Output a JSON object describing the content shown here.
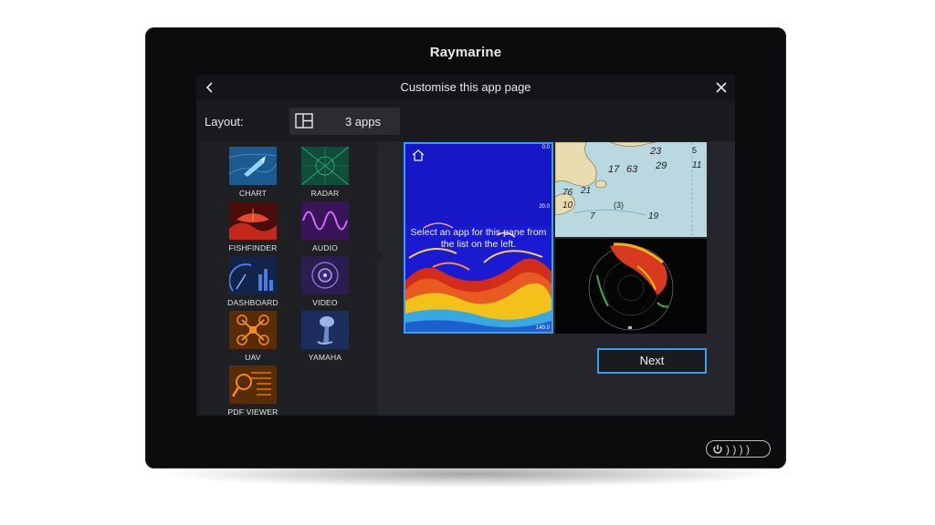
{
  "device": {
    "brand": "Raymarine"
  },
  "header": {
    "title": "Customise this app page",
    "back_icon": "chevron-left-icon",
    "close_icon": "close-icon"
  },
  "layout": {
    "label": "Layout:",
    "value": "3 apps",
    "icon": "layout-three-pane-icon"
  },
  "apps": [
    {
      "label": "CHART",
      "icon": "chart-app-icon"
    },
    {
      "label": "RADAR",
      "icon": "radar-app-icon"
    },
    {
      "label": "FISHFINDER",
      "icon": "fishfinder-app-icon"
    },
    {
      "label": "AUDIO",
      "icon": "audio-app-icon"
    },
    {
      "label": "DASHBOARD",
      "icon": "dashboard-app-icon"
    },
    {
      "label": "VIDEO",
      "icon": "video-app-icon"
    },
    {
      "label": "UAV",
      "icon": "uav-app-icon"
    },
    {
      "label": "YAMAHA",
      "icon": "yamaha-app-icon"
    },
    {
      "label": "PDF VIEWER",
      "icon": "pdf-viewer-app-icon"
    }
  ],
  "preview": {
    "instruction": "Select an app for this pane from the list on the left.",
    "depth_top": "0.0",
    "depth_mid": "20.0",
    "depth_bottom": "140.0",
    "chart_soundings": [
      "5",
      "23",
      "11",
      "17",
      "63",
      "29",
      "76",
      "21",
      "10",
      "7",
      "(3)",
      "19"
    ]
  },
  "actions": {
    "next_label": "Next"
  },
  "colors": {
    "accent": "#3b9cf0",
    "background": "#1a1b1f"
  }
}
